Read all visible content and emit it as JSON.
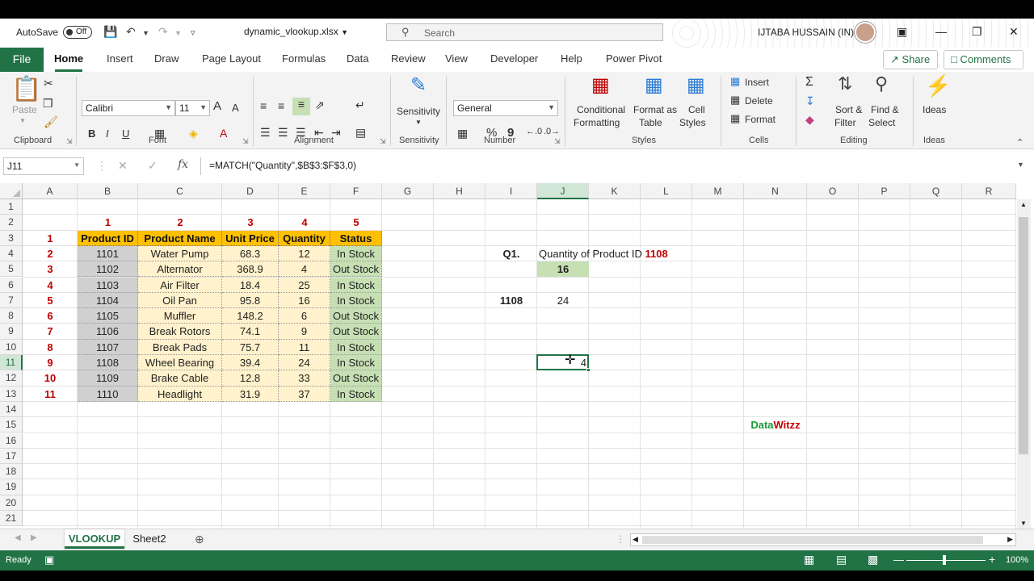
{
  "titlebar": {
    "autosave_label": "AutoSave",
    "autosave_state": "Off",
    "filename": "dynamic_vlookup.xlsx",
    "search_placeholder": "Search",
    "username": "IJTABA HUSSAIN (IN)"
  },
  "tabs": [
    "File",
    "Home",
    "Insert",
    "Draw",
    "Page Layout",
    "Formulas",
    "Data",
    "Review",
    "View",
    "Developer",
    "Help",
    "Power Pivot"
  ],
  "active_tab": "Home",
  "share_label": "Share",
  "comments_label": "Comments",
  "ribbon": {
    "clipboard": {
      "paste": "Paste",
      "label": "Clipboard"
    },
    "font": {
      "name": "Calibri",
      "size": "11",
      "label": "Font",
      "bold": "B",
      "italic": "I",
      "underline": "U",
      "grow": "A",
      "shrink": "A"
    },
    "alignment": {
      "label": "Alignment"
    },
    "sensitivity": {
      "button": "Sensitivity",
      "label": "Sensitivity"
    },
    "number": {
      "format": "General",
      "label": "Number",
      "percent": "%",
      "comma": "9"
    },
    "styles": {
      "conditional": "Conditional",
      "conditional2": "Formatting",
      "format_as": "Format as",
      "format_as2": "Table",
      "cell": "Cell",
      "cell2": "Styles",
      "label": "Styles"
    },
    "cells": {
      "insert": "Insert",
      "delete": "Delete",
      "format": "Format",
      "label": "Cells"
    },
    "editing": {
      "sort": "Sort &",
      "sort2": "Filter",
      "find": "Find &",
      "find2": "Select",
      "label": "Editing"
    },
    "ideas": {
      "button": "Ideas",
      "label": "Ideas"
    }
  },
  "formula_bar": {
    "name_box": "J11",
    "cancel": "✕",
    "enter": "✓",
    "fx": "fx",
    "formula": "=MATCH(\"Quantity\",$B$3:$F$3,0)"
  },
  "columns": [
    "A",
    "B",
    "C",
    "D",
    "E",
    "F",
    "G",
    "H",
    "I",
    "J",
    "K",
    "L",
    "M",
    "N",
    "O",
    "P",
    "Q",
    "R"
  ],
  "rows": [
    "1",
    "2",
    "3",
    "4",
    "5",
    "6",
    "7",
    "8",
    "9",
    "10",
    "11",
    "12",
    "13",
    "14",
    "15",
    "16",
    "17",
    "18",
    "19",
    "20",
    "21"
  ],
  "col_index_labels": [
    "1",
    "2",
    "3",
    "4",
    "5"
  ],
  "row_index_labels": [
    "1",
    "2",
    "3",
    "4",
    "5",
    "6",
    "7",
    "8",
    "9",
    "10",
    "11"
  ],
  "table": {
    "headers": [
      "Product ID",
      "Product Name",
      "Unit Price",
      "Quantity",
      "Status"
    ],
    "rows": [
      [
        "1101",
        "Water Pump",
        "68.3",
        "12",
        "In Stock"
      ],
      [
        "1102",
        "Alternator",
        "368.9",
        "4",
        "Out Stock"
      ],
      [
        "1103",
        "Air Filter",
        "18.4",
        "25",
        "In Stock"
      ],
      [
        "1104",
        "Oil Pan",
        "95.8",
        "16",
        "In Stock"
      ],
      [
        "1105",
        "Muffler",
        "148.2",
        "6",
        "Out Stock"
      ],
      [
        "1106",
        "Break Rotors",
        "74.1",
        "9",
        "Out Stock"
      ],
      [
        "1107",
        "Break Pads",
        "75.7",
        "11",
        "In Stock"
      ],
      [
        "1108",
        "Wheel Bearing",
        "39.4",
        "24",
        "In Stock"
      ],
      [
        "1109",
        "Brake Cable",
        "12.8",
        "33",
        "Out Stock"
      ],
      [
        "1110",
        "Headlight",
        "31.9",
        "37",
        "In Stock"
      ]
    ]
  },
  "question": {
    "label": "Q1.",
    "text": "Quantity of Product ID",
    "product_id": "1108",
    "answer": "16",
    "lookup_id": "1108",
    "lookup_result": "24",
    "match_result": "4"
  },
  "brand": {
    "part1": "Data",
    "part2": "Witzz"
  },
  "sheets": [
    "VLOOKUP",
    "Sheet2"
  ],
  "active_sheet": "VLOOKUP",
  "status": {
    "ready": "Ready",
    "zoom": "100%"
  },
  "colors": {
    "accent": "#217346",
    "header_fill": "#ffc000",
    "id_fill": "#d0d0d0",
    "body_fill": "#fff2cc",
    "status_fill": "#c6e0b4",
    "red_text": "#c00000"
  }
}
